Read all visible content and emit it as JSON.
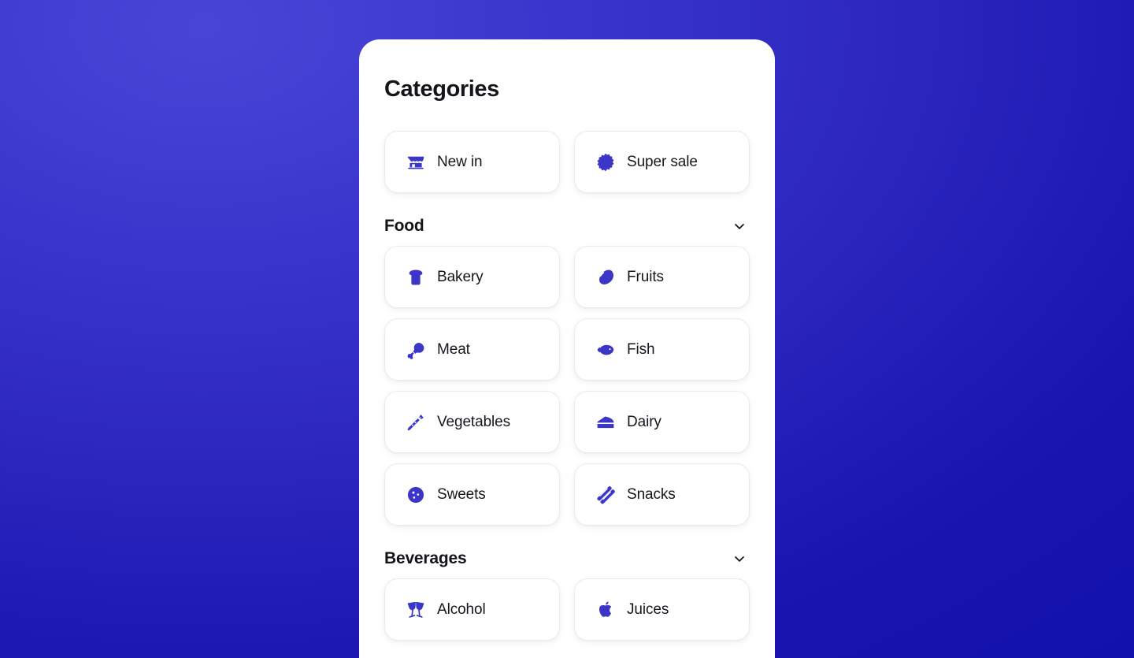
{
  "theme": {
    "accent": "#3b35c8",
    "text_primary": "#14151b",
    "card_bg": "#ffffff",
    "card_border": "#eaeaf0",
    "bg_gradient_from": "#4846d6",
    "bg_gradient_to": "#1211ad"
  },
  "page": {
    "title": "Categories"
  },
  "featured": [
    {
      "label": "New in",
      "icon": "storefront-icon"
    },
    {
      "label": "Super sale",
      "icon": "starburst-icon"
    }
  ],
  "sections": [
    {
      "title": "Food",
      "chevron": "chevron-down-icon",
      "expanded": true,
      "items": [
        {
          "label": "Bakery",
          "icon": "bread-icon"
        },
        {
          "label": "Fruits",
          "icon": "lemon-icon"
        },
        {
          "label": "Meat",
          "icon": "drumstick-icon"
        },
        {
          "label": "Fish",
          "icon": "fish-icon"
        },
        {
          "label": "Vegetables",
          "icon": "carrot-icon"
        },
        {
          "label": "Dairy",
          "icon": "cheese-icon"
        },
        {
          "label": "Sweets",
          "icon": "cookie-icon"
        },
        {
          "label": "Snacks",
          "icon": "chips-icon"
        }
      ]
    },
    {
      "title": "Beverages",
      "chevron": "chevron-down-icon",
      "expanded": true,
      "items": [
        {
          "label": "Alcohol",
          "icon": "champagne-glasses-icon"
        },
        {
          "label": "Juices",
          "icon": "apple-icon"
        }
      ]
    }
  ]
}
